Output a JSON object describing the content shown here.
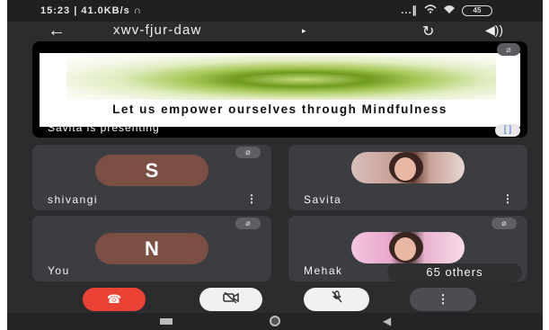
{
  "status_bar": {
    "time": "15:23 | 41.0KB/s ∩",
    "signal": "...∥",
    "wifi_icon": "wifi-icon",
    "battery": "45"
  },
  "header": {
    "back_icon": "←",
    "meeting_code": "xwv-fjur-daw",
    "dropdown_icon": "▸",
    "switch_camera_icon": "↻",
    "speaker_icon": "◀))"
  },
  "presentation": {
    "slide_text": "Let us empower ourselves through Mindfulness",
    "presenter_label": "Savita is presenting",
    "mic_icon": "⌀",
    "fullscreen_icon": "[ ]"
  },
  "participants": [
    {
      "name": "shivangi",
      "initial": "S",
      "has_more": true
    },
    {
      "name": "Savita",
      "initial": "",
      "has_more": true
    },
    {
      "name": "You",
      "initial": "N",
      "has_more": false
    },
    {
      "name": "Mehak",
      "initial": "",
      "has_more": false
    }
  ],
  "others": {
    "label": "65 others"
  },
  "controls": {
    "end_call_icon": "☎",
    "camera_icon": "▭̸",
    "mic_icon": "⌀",
    "more_icon": "⋮"
  },
  "colors": {
    "end_call": "#ea4335",
    "tile_bg": "#3c3d40",
    "app_bg": "#2b2c2e",
    "avatar_s": "#7b4f43"
  }
}
